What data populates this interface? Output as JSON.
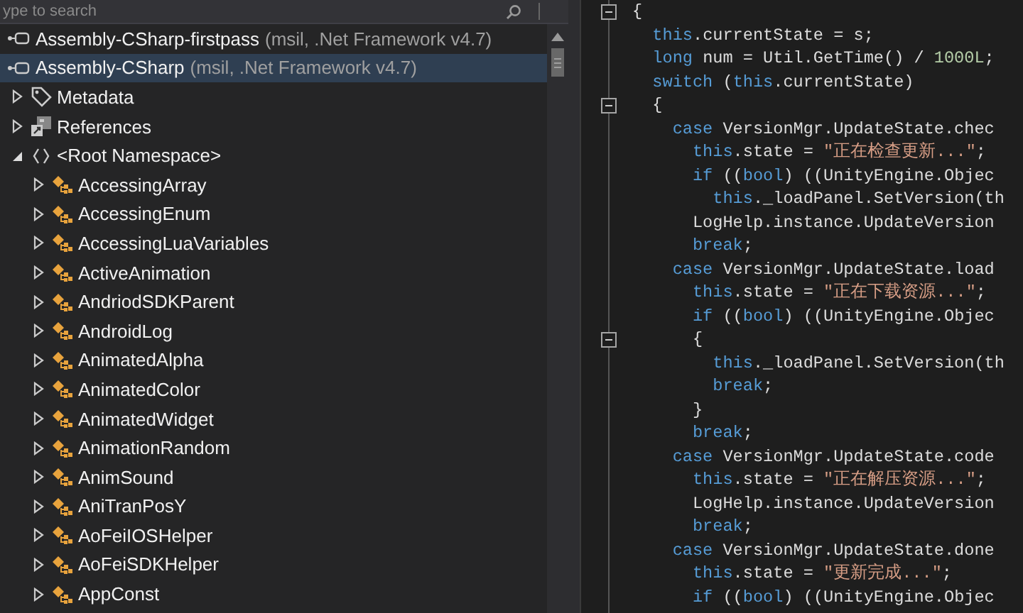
{
  "search": {
    "placeholder": "ype to search"
  },
  "assemblies": [
    {
      "name": "Assembly-CSharp-firstpass",
      "detail": "(msil, .Net Framework v4.7)",
      "selected": false
    },
    {
      "name": "Assembly-CSharp",
      "detail": "(msil, .Net Framework v4.7)",
      "selected": true,
      "children": [
        {
          "kind": "metadata",
          "label": "Metadata",
          "expanded": false
        },
        {
          "kind": "references",
          "label": "References",
          "expanded": false
        },
        {
          "kind": "namespace",
          "label": "<Root Namespace>",
          "expanded": true,
          "children": [
            {
              "kind": "class",
              "label": "AccessingArray",
              "expanded": false
            },
            {
              "kind": "class",
              "label": "AccessingEnum",
              "expanded": false
            },
            {
              "kind": "class",
              "label": "AccessingLuaVariables",
              "expanded": false
            },
            {
              "kind": "class",
              "label": "ActiveAnimation",
              "expanded": false
            },
            {
              "kind": "class",
              "label": "AndriodSDKParent",
              "expanded": false
            },
            {
              "kind": "class",
              "label": "AndroidLog",
              "expanded": false
            },
            {
              "kind": "class",
              "label": "AnimatedAlpha",
              "expanded": false
            },
            {
              "kind": "class",
              "label": "AnimatedColor",
              "expanded": false
            },
            {
              "kind": "class",
              "label": "AnimatedWidget",
              "expanded": false
            },
            {
              "kind": "class",
              "label": "AnimationRandom",
              "expanded": false
            },
            {
              "kind": "class",
              "label": "AnimSound",
              "expanded": false
            },
            {
              "kind": "class",
              "label": "AniTranPosY",
              "expanded": false
            },
            {
              "kind": "class",
              "label": "AoFeiIOSHelper",
              "expanded": false
            },
            {
              "kind": "class",
              "label": "AoFeiSDKHelper",
              "expanded": false
            },
            {
              "kind": "class",
              "label": "AppConst",
              "expanded": false
            }
          ]
        }
      ]
    }
  ],
  "code_lines": [
    {
      "fold_expanded": true,
      "tokens": [
        {
          "kind": "plain",
          "text": "{"
        }
      ]
    },
    {
      "tokens": [
        {
          "kind": "keyword",
          "text": "  this"
        },
        {
          "kind": "plain",
          "text": ".currentState = s;"
        }
      ]
    },
    {
      "tokens": [
        {
          "kind": "keyword",
          "text": "  long"
        },
        {
          "kind": "plain",
          "text": " num = Util.GetTime() / "
        },
        {
          "kind": "number",
          "text": "1000L"
        },
        {
          "kind": "plain",
          "text": ";"
        }
      ]
    },
    {
      "tokens": [
        {
          "kind": "keyword",
          "text": "  switch"
        },
        {
          "kind": "plain",
          "text": " ("
        },
        {
          "kind": "keyword",
          "text": "this"
        },
        {
          "kind": "plain",
          "text": ".currentState)"
        }
      ]
    },
    {
      "fold_expanded": true,
      "tokens": [
        {
          "kind": "plain",
          "text": "  {"
        }
      ]
    },
    {
      "tokens": [
        {
          "kind": "keyword",
          "text": "    case"
        },
        {
          "kind": "plain",
          "text": " VersionMgr.UpdateState.chec"
        }
      ]
    },
    {
      "tokens": [
        {
          "kind": "keyword",
          "text": "      this"
        },
        {
          "kind": "plain",
          "text": ".state = "
        },
        {
          "kind": "string",
          "text": "\"正在检查更新...\""
        },
        {
          "kind": "plain",
          "text": ";"
        }
      ]
    },
    {
      "tokens": [
        {
          "kind": "keyword",
          "text": "      if"
        },
        {
          "kind": "plain",
          "text": " (("
        },
        {
          "kind": "keyword",
          "text": "bool"
        },
        {
          "kind": "plain",
          "text": ") ((UnityEngine.Objec"
        }
      ]
    },
    {
      "tokens": [
        {
          "kind": "keyword",
          "text": "        this"
        },
        {
          "kind": "plain",
          "text": "._loadPanel.SetVersion(th"
        }
      ]
    },
    {
      "tokens": [
        {
          "kind": "plain",
          "text": "      LogHelp.instance.UpdateVersion"
        }
      ]
    },
    {
      "tokens": [
        {
          "kind": "keyword",
          "text": "      break"
        },
        {
          "kind": "plain",
          "text": ";"
        }
      ]
    },
    {
      "tokens": [
        {
          "kind": "keyword",
          "text": "    case"
        },
        {
          "kind": "plain",
          "text": " VersionMgr.UpdateState.load"
        }
      ]
    },
    {
      "tokens": [
        {
          "kind": "keyword",
          "text": "      this"
        },
        {
          "kind": "plain",
          "text": ".state = "
        },
        {
          "kind": "string",
          "text": "\"正在下载资源...\""
        },
        {
          "kind": "plain",
          "text": ";"
        }
      ]
    },
    {
      "tokens": [
        {
          "kind": "keyword",
          "text": "      if"
        },
        {
          "kind": "plain",
          "text": " (("
        },
        {
          "kind": "keyword",
          "text": "bool"
        },
        {
          "kind": "plain",
          "text": ") ((UnityEngine.Objec"
        }
      ]
    },
    {
      "fold_expanded": true,
      "tokens": [
        {
          "kind": "plain",
          "text": "      {"
        }
      ]
    },
    {
      "tokens": [
        {
          "kind": "keyword",
          "text": "        this"
        },
        {
          "kind": "plain",
          "text": "._loadPanel.SetVersion(th"
        }
      ]
    },
    {
      "tokens": [
        {
          "kind": "keyword",
          "text": "        break"
        },
        {
          "kind": "plain",
          "text": ";"
        }
      ]
    },
    {
      "tokens": [
        {
          "kind": "plain",
          "text": "      }"
        }
      ]
    },
    {
      "tokens": [
        {
          "kind": "keyword",
          "text": "      break"
        },
        {
          "kind": "plain",
          "text": ";"
        }
      ]
    },
    {
      "tokens": [
        {
          "kind": "keyword",
          "text": "    case"
        },
        {
          "kind": "plain",
          "text": " VersionMgr.UpdateState.code"
        }
      ]
    },
    {
      "tokens": [
        {
          "kind": "keyword",
          "text": "      this"
        },
        {
          "kind": "plain",
          "text": ".state = "
        },
        {
          "kind": "string",
          "text": "\"正在解压资源...\""
        },
        {
          "kind": "plain",
          "text": ";"
        }
      ]
    },
    {
      "tokens": [
        {
          "kind": "plain",
          "text": "      LogHelp.instance.UpdateVersion"
        }
      ]
    },
    {
      "tokens": [
        {
          "kind": "keyword",
          "text": "      break"
        },
        {
          "kind": "plain",
          "text": ";"
        }
      ]
    },
    {
      "tokens": [
        {
          "kind": "keyword",
          "text": "    case"
        },
        {
          "kind": "plain",
          "text": " VersionMgr.UpdateState.done"
        }
      ]
    },
    {
      "tokens": [
        {
          "kind": "keyword",
          "text": "      this"
        },
        {
          "kind": "plain",
          "text": ".state = "
        },
        {
          "kind": "string",
          "text": "\"更新完成...\""
        },
        {
          "kind": "plain",
          "text": ";"
        }
      ]
    },
    {
      "tokens": [
        {
          "kind": "keyword",
          "text": "      if"
        },
        {
          "kind": "plain",
          "text": " (("
        },
        {
          "kind": "keyword",
          "text": "bool"
        },
        {
          "kind": "plain",
          "text": ") ((UnityEngine.Objec"
        }
      ]
    }
  ]
}
